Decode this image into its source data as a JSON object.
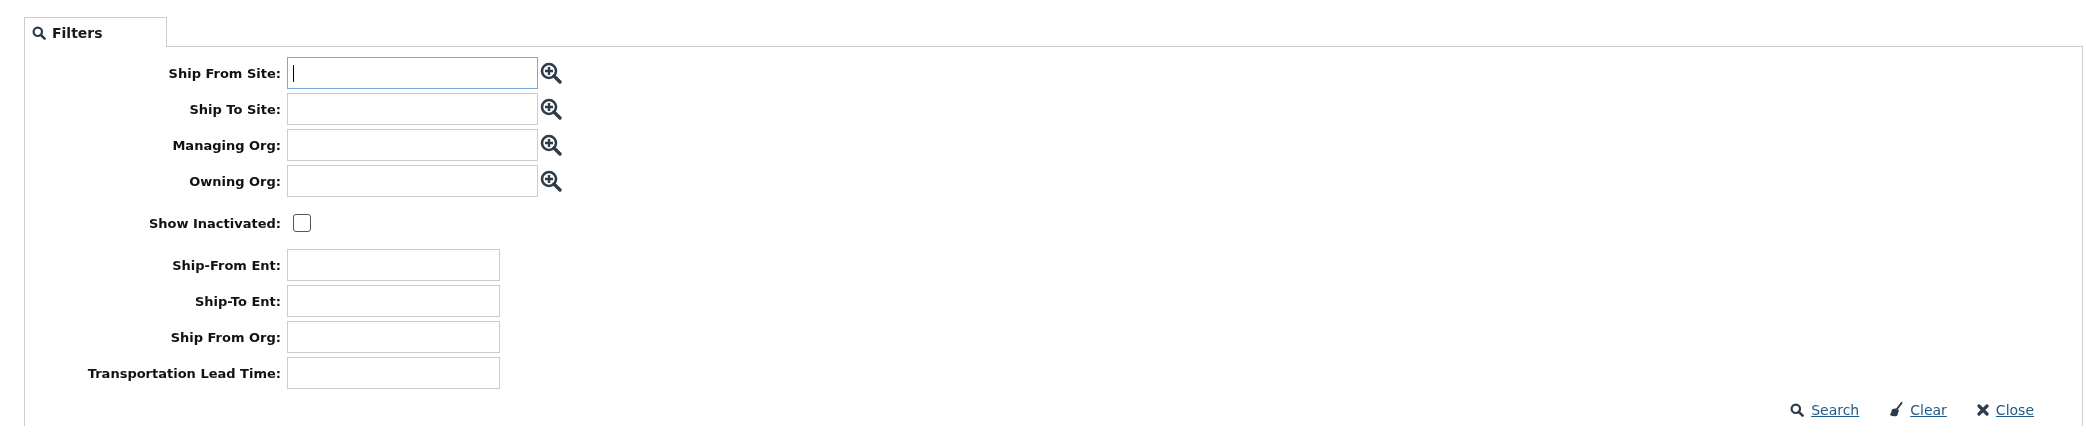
{
  "tab": {
    "label": "Filters",
    "selected": true
  },
  "fields": [
    {
      "kind": "lookup",
      "label": "Ship From Site:",
      "focused": true
    },
    {
      "kind": "lookup",
      "label": "Ship To Site:",
      "focused": false
    },
    {
      "kind": "lookup",
      "label": "Managing Org:",
      "focused": false
    },
    {
      "kind": "lookup",
      "label": "Owning Org:",
      "focused": false
    },
    {
      "kind": "checkbox",
      "label": "Show Inactivated:",
      "checked": false
    },
    {
      "kind": "text",
      "label": "Ship-From Ent:",
      "focused": false
    },
    {
      "kind": "text",
      "label": "Ship-To Ent:",
      "focused": false
    },
    {
      "kind": "text",
      "label": "Ship From Org:",
      "focused": false
    },
    {
      "kind": "text",
      "label": "Transportation Lead Time:",
      "focused": false
    }
  ],
  "actions": [
    {
      "kind": "search",
      "label": "Search"
    },
    {
      "kind": "clear",
      "label": "Clear"
    },
    {
      "kind": "close",
      "label": "Close"
    }
  ]
}
